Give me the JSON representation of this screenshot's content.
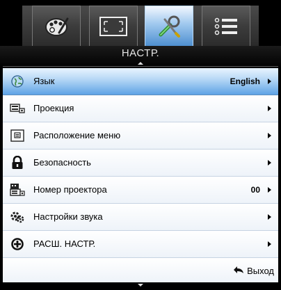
{
  "tabs": [
    {
      "icon": "palette-icon",
      "active": false
    },
    {
      "icon": "screen-frame-icon",
      "active": false
    },
    {
      "icon": "tools-icon",
      "active": true
    },
    {
      "icon": "list-icon",
      "active": false
    }
  ],
  "title": "НАСТР.",
  "items": [
    {
      "icon": "globe-icon",
      "label": "Язык",
      "value": "English",
      "selected": true
    },
    {
      "icon": "projection-icon",
      "label": "Проекция",
      "value": "",
      "selected": false
    },
    {
      "icon": "menu-location-icon",
      "label": "Расположение меню",
      "value": "",
      "selected": false
    },
    {
      "icon": "lock-icon",
      "label": "Безопасность",
      "value": "",
      "selected": false
    },
    {
      "icon": "projector-id-icon",
      "label": "Номер проектора",
      "value": "00",
      "selected": false
    },
    {
      "icon": "sound-settings-icon",
      "label": "Настройки звука",
      "value": "",
      "selected": false
    },
    {
      "icon": "advanced-plus-icon",
      "label": "РАСШ. НАСТР.",
      "value": "",
      "selected": false
    }
  ],
  "exit_label": "Выход",
  "colors": {
    "selected_row": "#5ea3e5",
    "active_tab": "#4e8fd0",
    "frame": "#000000"
  }
}
